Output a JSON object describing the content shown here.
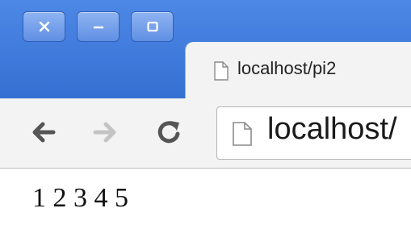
{
  "window": {
    "controls": [
      "close",
      "minimize",
      "maximize"
    ]
  },
  "tab": {
    "title": "localhost/pi2",
    "icon": "page-icon"
  },
  "toolbar": {
    "back_icon": "back-arrow-icon",
    "forward_icon": "forward-arrow-icon",
    "reload_icon": "reload-icon",
    "address": "localhost/"
  },
  "page": {
    "text": "1 2 3 4 5"
  },
  "colors": {
    "titlebar": "#3f79da",
    "toolbar": "#f3f3f3"
  }
}
